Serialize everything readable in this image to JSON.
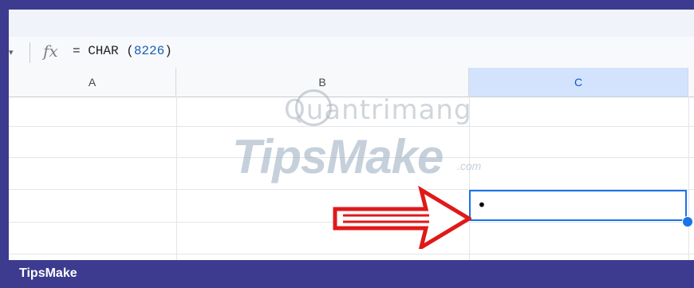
{
  "formula_bar": {
    "fx_label": "fx",
    "formula_prefix": "= CHAR (",
    "formula_number": "8226",
    "formula_suffix": ")"
  },
  "columns": [
    "A",
    "B",
    "C"
  ],
  "active_column": "C",
  "selected_cell": {
    "value": "•"
  },
  "watermarks": {
    "quantrimang": "Quantrimang",
    "tipsmake": "TipsMake",
    "tipsmake_suffix": ".com"
  },
  "footer": {
    "label": "TipsMake"
  },
  "colors": {
    "frame": "#3c3b8f",
    "selection": "#1a73e8",
    "arrow": "#e01919"
  }
}
